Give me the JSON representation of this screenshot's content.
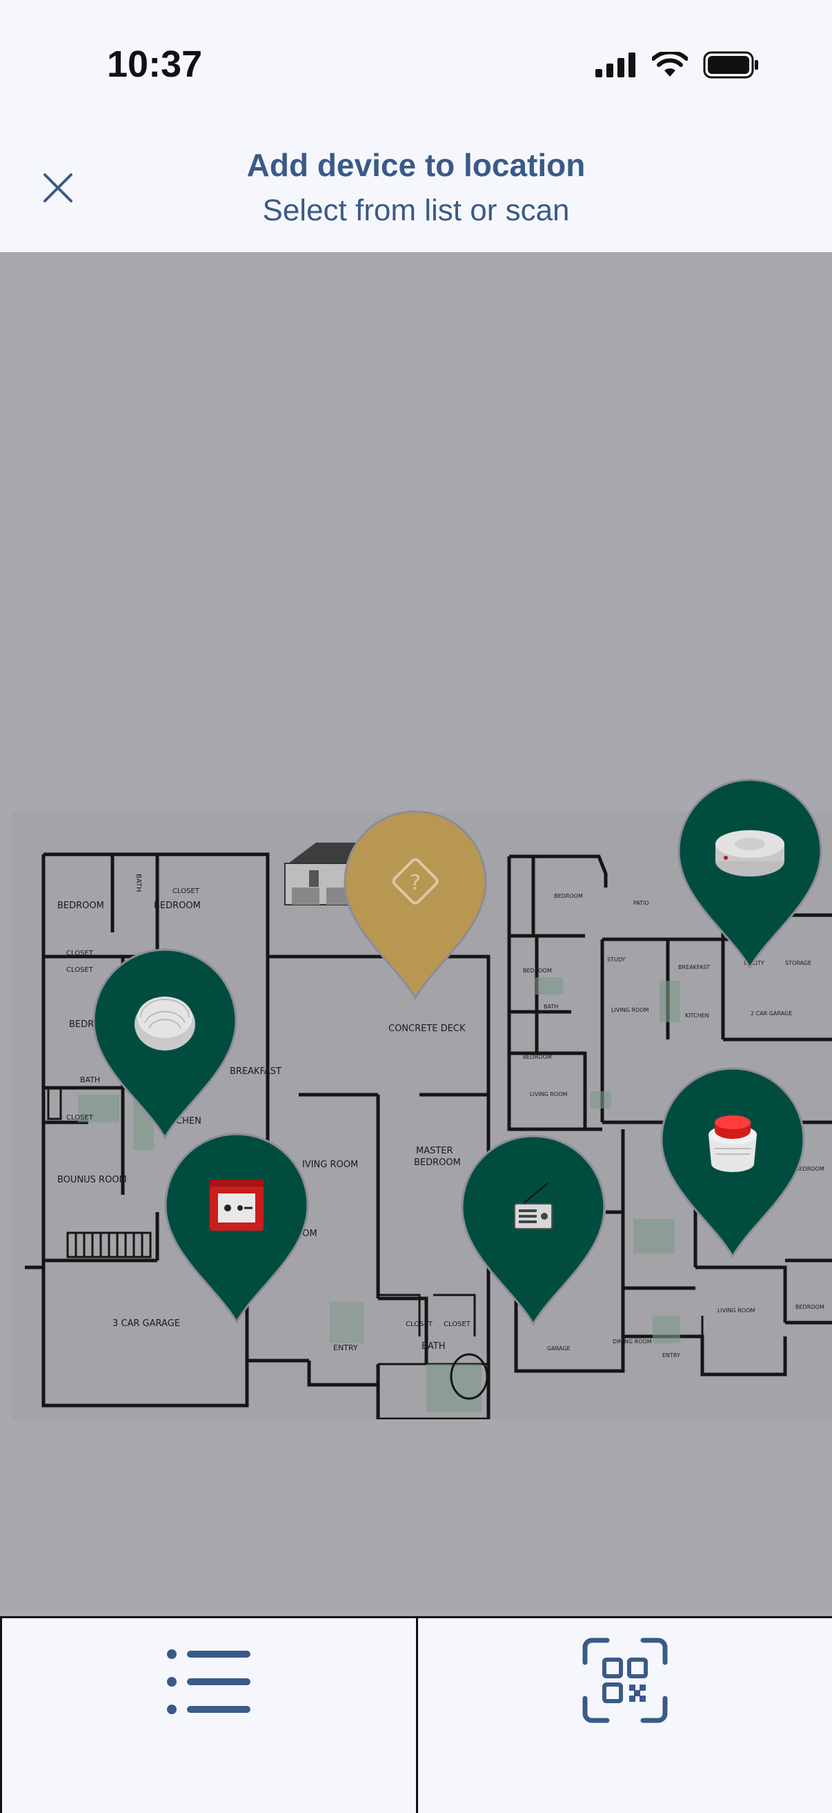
{
  "status": {
    "time": "10:37"
  },
  "header": {
    "title": "Add device to location",
    "subtitle": "Select from list or scan"
  },
  "floorplan": {
    "labels": {
      "bedroom1": "BEDROOM",
      "bath1": "BATH",
      "closet1": "CLOSET",
      "bedroom2": "BEDROOM",
      "closet2": "CLOSET",
      "closet3": "CLOSET",
      "bedroom3": "BEDR",
      "bath2": "BATH",
      "closet4": "CLOSET",
      "concrete_deck": "CONCRETE DECK",
      "breakfast": "BREAKFAST",
      "kitchen": "CHEN",
      "bonus_room": "BOUNUS ROOM",
      "living_room": "IVING ROOM",
      "master1": "MASTER",
      "master2": "BEDROOM",
      "dining": "OOM",
      "closet5": "CLOSET",
      "closet6": "CLOSET",
      "garage": "3 CAR GARAGE",
      "entry": "ENTRY",
      "bath3": "BATH",
      "r_bedroom1": "BEDROOM",
      "r_patio": "PATIO",
      "r_bedroom2": "BEDROOM",
      "r_study": "STUDY",
      "r_breakfast": "BREAKFAST",
      "r_utility": "UTILITY",
      "r_storage": "STORAGE",
      "r_bath": "BATH",
      "r_living1": "LIVING ROOM",
      "r_kitchen": "KITCHEN",
      "r_garage2": "2 CAR GARAGE",
      "r_bedroom3": "BEDROOM",
      "r_living2": "LIVING ROOM",
      "r_bedroom4": "BEDROOM",
      "r_living3": "LIVING ROOM",
      "r_bedroom5": "BEDROOM",
      "r_garage": "GARAGE",
      "r_dining": "DINING ROOM",
      "r_entry": "ENTRY"
    }
  },
  "pins": [
    {
      "name": "unknown-device-pin",
      "color": "#b89752",
      "icon": "question-diamond-icon"
    },
    {
      "name": "smoke-detector-pin",
      "color": "#004d40",
      "icon": "smoke-detector-icon"
    },
    {
      "name": "smoke-detector-pin",
      "color": "#004d40",
      "icon": "smoke-detector-icon"
    },
    {
      "name": "call-point-pin",
      "color": "#004d40",
      "icon": "manual-call-point-icon"
    },
    {
      "name": "radio-device-pin",
      "color": "#004d40",
      "icon": "radio-icon"
    },
    {
      "name": "sounder-pin",
      "color": "#004d40",
      "icon": "sounder-beacon-icon"
    }
  ],
  "bottom_bar": {
    "left_icon": "list-icon",
    "right_icon": "qr-scan-icon"
  },
  "colors": {
    "accent": "#3a5a88",
    "pin_green": "#004d40",
    "pin_gold": "#b89752",
    "overlay": "#a9a8ae"
  }
}
